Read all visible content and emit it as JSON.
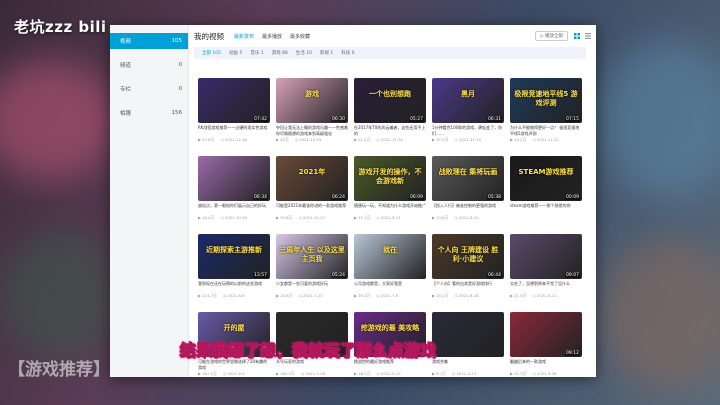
{
  "overlay": {
    "logo": "老坑zzz bili",
    "background_text": "【游戏推荐】202",
    "subtitle": "结果我想了想，我就玩了那么点游戏"
  },
  "sidebar": {
    "items": [
      {
        "label": "视频",
        "count": "105"
      },
      {
        "label": "频道",
        "count": "0"
      },
      {
        "label": "专栏",
        "count": "0"
      },
      {
        "label": "相簿",
        "count": "156"
      }
    ]
  },
  "header": {
    "title": "我的视频",
    "tabs": [
      "最新发布",
      "最多播放",
      "最多收藏"
    ],
    "play_all": "▷ 播放全部"
  },
  "filters": [
    "全部 105",
    "动画 5",
    "音乐 1",
    "游戏 88",
    "生活 10",
    "影视 1",
    "科技 0"
  ],
  "cards": [
    {
      "title": "RK战役游戏推荐——过硬的现实性游戏",
      "views": "37.6万",
      "date": "2021-12-16",
      "dur": "07:42",
      "label": "",
      "color": "#3a2a6a"
    },
    {
      "title": "夺回让我无法上瘾的游戏乐趣——性感着你尽情随想的游戏来到高级强化",
      "views": "42万",
      "date": "2021-12-19",
      "dur": "06:30",
      "label": "游戏",
      "color": "#d8a0b8"
    },
    {
      "title": "在2017年TX的风云编者，这些还用不上的",
      "views": "21.2万",
      "date": "2021-11-30",
      "dur": "05:27",
      "label": "一个也别想跑",
      "color": "#2a1e3a"
    },
    {
      "title": "1分钟看完100款的游戏，耕耘变了，你们……",
      "views": "37.4万",
      "date": "2021-11-19",
      "dur": "06:31",
      "label": "黑月",
      "color": "#4a3a8a"
    },
    {
      "title": "为什么不能做得更好一点？ 极限竞速地平线5游戏评测",
      "views": "15.2万",
      "date": "2021-11-12",
      "dur": "07:15",
      "label": "极限竞速地平线5 游戏评测",
      "color": "#1e3a5a"
    },
    {
      "title": "放松点，第一眼给你们展示自己的好玩",
      "views": "16.4万",
      "date": "2021-10-29",
      "dur": "06:34",
      "label": "",
      "color": "#9a6aaa"
    },
    {
      "title": "可能是2021年最该你进的一款游戏推荐",
      "views": "35.8万",
      "date": "2021-10-12",
      "dur": "06:24",
      "label": "2021年",
      "color": "#6a4a3a"
    },
    {
      "title": "随便玩一玩，不知道为什么游戏开始推广",
      "views": "15.1万",
      "date": "2021-9-17",
      "dur": "06:09",
      "label": "游戏开发的操作，不会游戏新",
      "color": "#4a5a2a"
    },
    {
      "title": "【投入人行】被谁控制的更强的游戏",
      "views": "13.6万",
      "date": "2021-8-21",
      "dur": "05:38",
      "label": "战败理在 集将玩画",
      "color": "#5a5a5a"
    },
    {
      "title": "steam游戏推荐——那个熟悉的你",
      "views": "",
      "date": "",
      "dur": "00:09",
      "label": "STEAM游戏推荐",
      "color": "#1a1a1a"
    },
    {
      "title": "我到现在还在玩啊的以前的这些游戏",
      "views": "114.7万",
      "date": "2021-8-6",
      "dur": "13:57",
      "label": "近期探索主游推新",
      "color": "#1a2a6a"
    },
    {
      "title": "少女都是一些可爱的游戏好玩",
      "views": "25.8万",
      "date": "2021-7-23",
      "dur": "05:24",
      "label": "三周年人生 以及这里 主页我",
      "color": "#d8c8e8"
    },
    {
      "title": "公司游戏都是，大家好我是",
      "views": "29.2万",
      "date": "2021-7-9",
      "dur": "",
      "label": "就在",
      "color": "#b8c8d8"
    },
    {
      "title": "【个人向】看的出其是好游戏排行",
      "views": "19.2万",
      "date": "2021-6-18",
      "dur": "06:44",
      "label": "个人向 王牌建设 胜利·小建议",
      "color": "#4a3a2a"
    },
    {
      "title": "太吃了，没想到原来不完了没什么",
      "views": "21.5万",
      "date": "2021-6-11",
      "dur": "09:07",
      "label": "",
      "color": "#5a4a6a"
    },
    {
      "title": "可能在游戏的世界里做选择了20有趣的游戏",
      "views": "167.2万",
      "date": "2021-6-5",
      "dur": "",
      "label": "开的屋",
      "color": "#6a5aaa"
    },
    {
      "title": "头号玩家的游戏",
      "views": "160.2万",
      "date": "2021-5-26",
      "dur": "",
      "label": "",
      "color": "#2a2a2a"
    },
    {
      "title": "挑战控的最好游戏推荐",
      "views": "18.2万",
      "date": "2021-5-10",
      "dur": "",
      "label": "挖游戏的最 美攻略",
      "color": "#6a2a8a"
    },
    {
      "title": "游戏合集",
      "views": "6.7万",
      "date": "2021-4-23",
      "dur": "",
      "label": "",
      "color": "#2a2a3a"
    },
    {
      "title": "翻越后来的一款游戏",
      "views": "21.3万",
      "date": "2021-3-26",
      "dur": "09:12",
      "label": "",
      "color": "#8a2a3a"
    }
  ]
}
